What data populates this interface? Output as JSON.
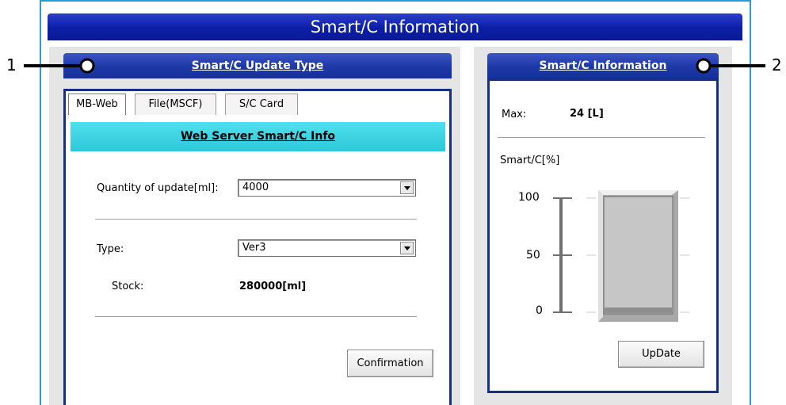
{
  "window": {
    "title": "Smart/C Information"
  },
  "update_panel": {
    "header": "Smart/C Update Type",
    "tabs": [
      {
        "label": "MB-Web",
        "active": true
      },
      {
        "label": "File(MSCF)",
        "active": false
      },
      {
        "label": "S/C Card",
        "active": false
      }
    ],
    "banner": "Web Server Smart/C Info",
    "quantity_label": "Quantity of update[ml]:",
    "quantity_value": "4000",
    "type_label": "Type:",
    "type_value": "Ver3",
    "stock_label": "Stock:",
    "stock_value": "280000[ml]",
    "confirm_label": "Confirmation"
  },
  "info_panel": {
    "header": "Smart/C Information",
    "max_label": "Max:",
    "max_value": "24 [L]",
    "gauge_label": "Smart/C[%]",
    "gauge_ticks": [
      "100",
      "50",
      "0"
    ],
    "gauge_fill_percent": 5,
    "update_label": "UpDate"
  },
  "callouts": {
    "left": "1",
    "right": "2"
  },
  "colors": {
    "title_blue": "#0b1ea6",
    "banner_cyan": "#2ec7db",
    "frame_blue": "#2a9ad8"
  }
}
